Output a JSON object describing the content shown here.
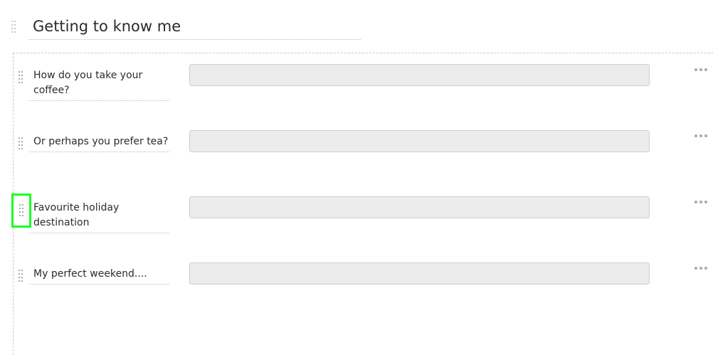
{
  "section": {
    "title": "Getting to know me"
  },
  "questions": [
    {
      "label": "How do you take your coffee?",
      "value": "",
      "placeholder": ""
    },
    {
      "label": "Or perhaps you prefer tea?",
      "value": "",
      "placeholder": ""
    },
    {
      "label": "Favourite holiday destination",
      "value": "",
      "placeholder": ""
    },
    {
      "label": "My perfect weekend....",
      "value": "",
      "placeholder": ""
    }
  ],
  "icons": {
    "drag": "drag-handle-icon",
    "more": "more-options-icon"
  },
  "colors": {
    "field_background": "#ececec",
    "field_border": "#cfcfcf",
    "underline": "#9fc5dd",
    "highlight": "#1aff22"
  }
}
